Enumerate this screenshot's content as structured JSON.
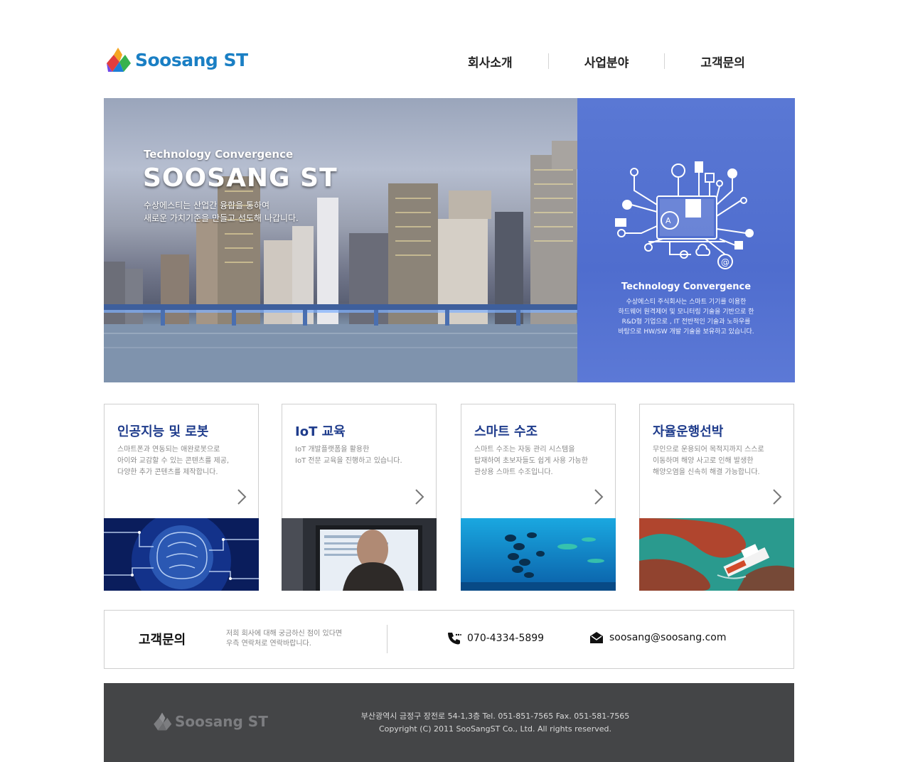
{
  "brand": {
    "name": "Soosang ST",
    "color": "#1a7fc4"
  },
  "nav": {
    "items": [
      {
        "label": "회사소개"
      },
      {
        "label": "사업분야"
      },
      {
        "label": "고객문의"
      }
    ]
  },
  "hero": {
    "subtitle": "Technology Convergence",
    "title": "SOOSANG ST",
    "description": "수상에스티는 산업간 융합을 통하여\n새로운 가치기준을 만들고 선도해 나갑니다.",
    "panel": {
      "title": "Technology Convergence",
      "description": "수상에스티 주식회사는 스마트 기기를 이용한\n하드웨어 원격제어 및 모니터링 기술을 기반으로 한\nR&D형 기업으로 , IT 전반적인 기술과 노하우를\n바탕으로 HW/SW 개발 기술을 보유하고 있습니다.",
      "color": "#5572d2"
    }
  },
  "cards": [
    {
      "title": "인공지능 및 로봇",
      "description": "스마트폰과 연동되는 애완로봇으로\n아이와 교감할 수 있는 콘텐츠를 제공,\n다양한 추가 콘텐츠를 제작합니다.",
      "image": "ai-brain-circuit"
    },
    {
      "title": "IoT 교육",
      "description": "IoT 개발플랫폼을 활용한\nIoT 전문 교육을 진행하고 있습니다.",
      "image": "person-at-monitor"
    },
    {
      "title": "스마트 수조",
      "description": "스마트 수조는 자동 관리 시스템을\n탑재하여 초보자들도 쉽게 사용 가능한\n관상용 스마트 수조입니다.",
      "image": "aquarium-fish"
    },
    {
      "title": "자율운행선박",
      "description": "무인으로 운용되어 목적지까지 스스로\n이동하며 해양 사고로 인해 발생한\n해양오염을 신속히 해결 가능합니다.",
      "image": "ship-oil-spill"
    }
  ],
  "contact": {
    "title": "고객문의",
    "description": "저희 회사에 대해 궁금하신 점이 있다면\n우측 연락처로 연락바랍니다.",
    "phone": "070-4334-5899",
    "email": "soosang@soosang.com"
  },
  "footer": {
    "logo_text": "Soosang ST",
    "address": "부산광역시 금정구 장전로 54-1,3층  Tel. 051-851-7565    Fax. 051-581-7565",
    "copyright": "Copyright (C) 2011 SooSangST Co., Ltd. All rights reserved."
  }
}
